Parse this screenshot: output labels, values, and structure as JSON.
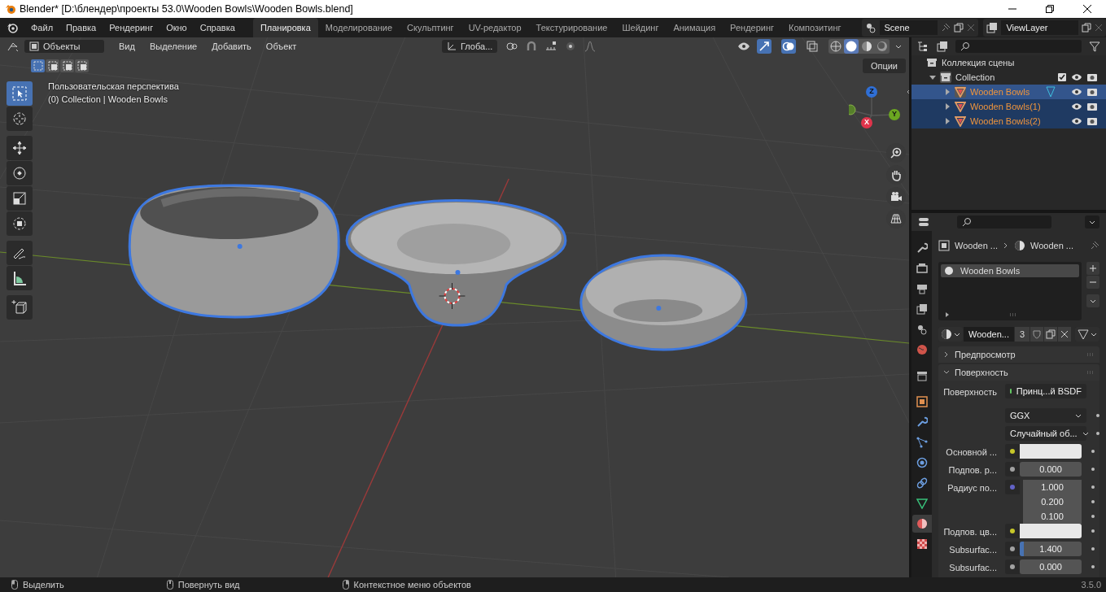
{
  "window": {
    "title": "Blender* [D:\\блендер\\проекты 53.0\\Wooden Bowls\\Wooden Bowls.blend]"
  },
  "menu": [
    "Файл",
    "Правка",
    "Рендеринг",
    "Окно",
    "Справка"
  ],
  "workspaces": [
    {
      "label": "Планировка",
      "selected": true
    },
    {
      "label": "Моделирование",
      "selected": false
    },
    {
      "label": "Скульптинг",
      "selected": false
    },
    {
      "label": "UV-редактор",
      "selected": false
    },
    {
      "label": "Текстурирование",
      "selected": false
    },
    {
      "label": "Шейдинг",
      "selected": false
    },
    {
      "label": "Анимация",
      "selected": false
    },
    {
      "label": "Рендеринг",
      "selected": false
    },
    {
      "label": "Композитинг",
      "selected": false
    }
  ],
  "scene": {
    "name": "Scene"
  },
  "view_layer": {
    "name": "ViewLayer"
  },
  "viewport": {
    "mode": "Объекты",
    "menus": [
      "Вид",
      "Выделение",
      "Добавить",
      "Объект"
    ],
    "orientation": "Глоба...",
    "options": "Опции",
    "select_modes": [
      {
        "selected": true
      },
      {
        "selected": false
      },
      {
        "selected": false
      },
      {
        "selected": false
      }
    ],
    "gizmos_on": true,
    "overlays_on": true,
    "shading": [
      {
        "kind": "wireframe",
        "selected": false
      },
      {
        "kind": "solid",
        "selected": true
      },
      {
        "kind": "material",
        "selected": false
      },
      {
        "kind": "rendered",
        "selected": false
      }
    ],
    "overlay_lines": [
      "Пользовательская перспектива",
      "(0) Collection | Wooden Bowls"
    ],
    "tools": [
      {
        "kind": "select",
        "selected": true
      },
      {
        "kind": "cursor",
        "selected": false
      },
      {
        "kind": "move",
        "selected": false
      },
      {
        "kind": "rotate",
        "selected": false
      },
      {
        "kind": "scale",
        "selected": false
      },
      {
        "kind": "transform",
        "selected": false
      },
      {
        "kind": "annotate",
        "selected": false
      },
      {
        "kind": "measure",
        "selected": false
      },
      {
        "kind": "add-cube",
        "selected": false
      }
    ],
    "axes": [
      "Z",
      "Y",
      "X"
    ]
  },
  "outliner": {
    "root": "Коллекция сцены",
    "collections": [
      {
        "label": "Collection",
        "expanded": true,
        "children": [
          {
            "label": "Wooden Bowls",
            "selected": true,
            "active": true
          },
          {
            "label": "Wooden Bowls(1)",
            "selected": true,
            "active": false
          },
          {
            "label": "Wooden Bowls(2)",
            "selected": true,
            "active": false
          }
        ]
      }
    ]
  },
  "properties": {
    "breadcrumb": [
      "Wooden ...",
      "Wooden ..."
    ],
    "tabs": [
      {
        "kind": "tool",
        "selected": false
      },
      {
        "kind": "render",
        "selected": false
      },
      {
        "kind": "output",
        "selected": false
      },
      {
        "kind": "view-layer",
        "selected": false
      },
      {
        "kind": "scene",
        "selected": false
      },
      {
        "kind": "world",
        "selected": false
      },
      {
        "kind": "collection",
        "selected": false
      },
      {
        "kind": "object",
        "selected": false
      },
      {
        "kind": "modifiers",
        "selected": false
      },
      {
        "kind": "particles",
        "selected": false
      },
      {
        "kind": "physics",
        "selected": false
      },
      {
        "kind": "constraints",
        "selected": false
      },
      {
        "kind": "data",
        "selected": false
      },
      {
        "kind": "material",
        "selected": true
      },
      {
        "kind": "texture",
        "selected": false
      }
    ],
    "slots": [
      {
        "label": "Wooden Bowls",
        "selected": true
      }
    ],
    "material": {
      "name": "Wooden...",
      "users": "3"
    },
    "panels": [
      {
        "label": "Предпросмотр",
        "expanded": false
      },
      {
        "label": "Поверхность",
        "expanded": true
      }
    ],
    "fields": [
      {
        "kind": "shader",
        "label": "Поверхность",
        "value": "Принц...й BSDF",
        "color": "#63c763"
      },
      {
        "kind": "dropdown",
        "value": "GGX"
      },
      {
        "kind": "dropdown",
        "value": "Случайный об..."
      },
      {
        "kind": "color",
        "label": "Основной ...",
        "color": "#c7c729"
      },
      {
        "kind": "number",
        "label": "Подпов. р...",
        "value": "0.000",
        "color": "#a1a1a1"
      },
      {
        "kind": "vector",
        "label": "Радиус по...",
        "values": [
          "1.000",
          "0.200",
          "0.100"
        ],
        "color": "#6363c7"
      },
      {
        "kind": "color",
        "label": "Подпов. цв...",
        "color": "#c7c729"
      },
      {
        "kind": "slider",
        "label": "Subsurfac...",
        "value": "1.400",
        "level": 0.06,
        "color": "#a1a1a1"
      },
      {
        "kind": "number",
        "label": "Subsurfac...",
        "value": "0.000",
        "color": "#a1a1a1"
      }
    ]
  },
  "status_bar": {
    "items": [
      "Выделить",
      "Повернуть вид",
      "Контекстное меню объектов"
    ],
    "version": "3.5.0"
  }
}
